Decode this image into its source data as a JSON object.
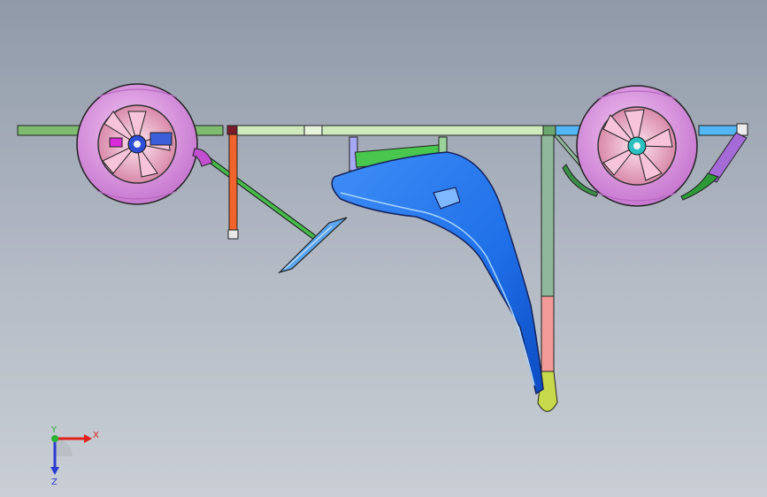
{
  "viewport": {
    "background_top": "#8f99a8",
    "background_bottom": "#c9ced5"
  },
  "triad": {
    "x_label": "X",
    "y_label": "Y",
    "z_label": "Z",
    "x_color": "#e0201a",
    "y_color": "#29b233",
    "z_color": "#2a3bd0"
  },
  "parts": {
    "wheel_color": "#e69ee6",
    "frame_color": "#6fae6a",
    "fender_color": "#2f7bf5",
    "strut_color": "#f06a2a"
  }
}
